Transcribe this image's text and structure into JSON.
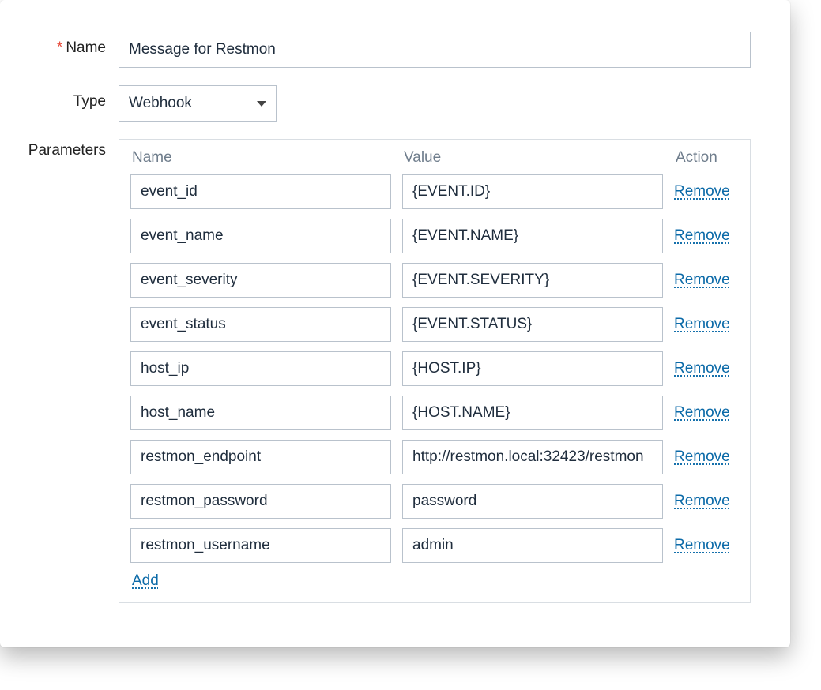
{
  "labels": {
    "name": "Name",
    "type": "Type",
    "parameters": "Parameters",
    "required_mark": "*"
  },
  "fields": {
    "name_value": "Message for Restmon",
    "type_value": "Webhook"
  },
  "params_header": {
    "name": "Name",
    "value": "Value",
    "action": "Action"
  },
  "actions": {
    "remove": "Remove",
    "add": "Add"
  },
  "parameters": [
    {
      "name": "event_id",
      "value": "{EVENT.ID}"
    },
    {
      "name": "event_name",
      "value": "{EVENT.NAME}"
    },
    {
      "name": "event_severity",
      "value": "{EVENT.SEVERITY}"
    },
    {
      "name": "event_status",
      "value": "{EVENT.STATUS}"
    },
    {
      "name": "host_ip",
      "value": "{HOST.IP}"
    },
    {
      "name": "host_name",
      "value": "{HOST.NAME}"
    },
    {
      "name": "restmon_endpoint",
      "value": "http://restmon.local:32423/restmon"
    },
    {
      "name": "restmon_password",
      "value": "password"
    },
    {
      "name": "restmon_username",
      "value": "admin"
    }
  ]
}
